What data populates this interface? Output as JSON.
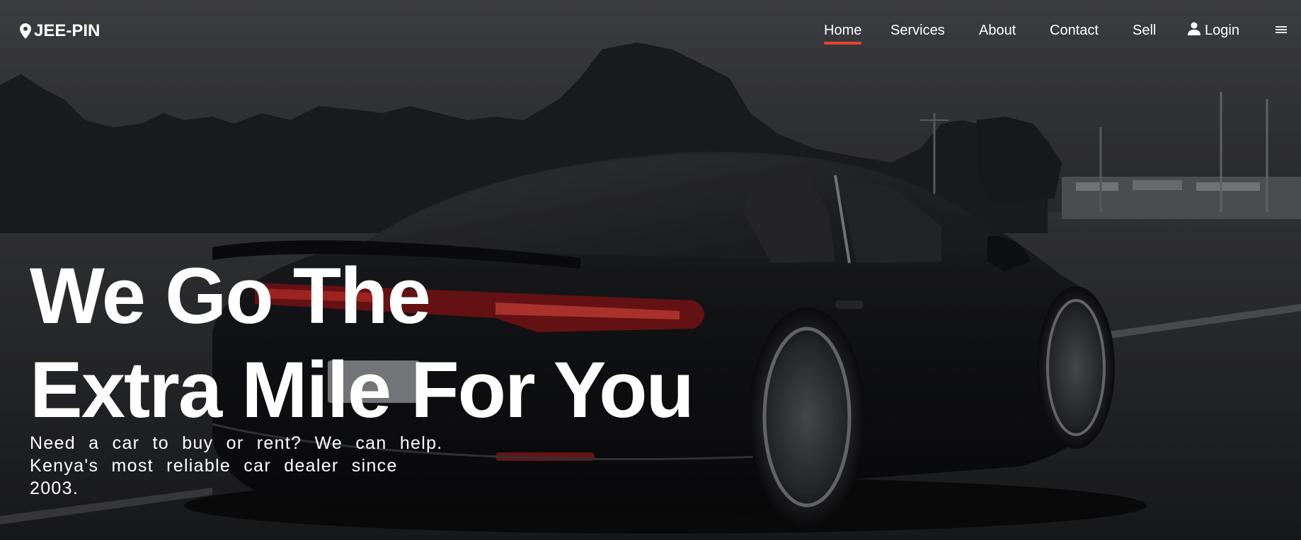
{
  "brand": {
    "name": "JEE-PIN",
    "icon": "map-pin-icon"
  },
  "nav": {
    "items": [
      {
        "label": "Home",
        "active": true
      },
      {
        "label": "Services",
        "active": false
      },
      {
        "label": "About",
        "active": false
      },
      {
        "label": "Contact",
        "active": false
      },
      {
        "label": "Sell",
        "active": false
      },
      {
        "label": "Login",
        "active": false,
        "icon": "user-icon"
      }
    ],
    "menu_icon": "hamburger-menu-icon"
  },
  "hero": {
    "title_line1": "We Go The",
    "title_line2": "Extra Mile For You",
    "subtitle_line1": "Need a car to buy or rent? We can help.",
    "subtitle_line2": "Kenya's most reliable car dealer since 2003.",
    "background": "dark sports car driving on highway at dusk"
  },
  "colors": {
    "accent": "#e5462c",
    "text": "#ffffff",
    "overlay": "#2a2b2e"
  }
}
